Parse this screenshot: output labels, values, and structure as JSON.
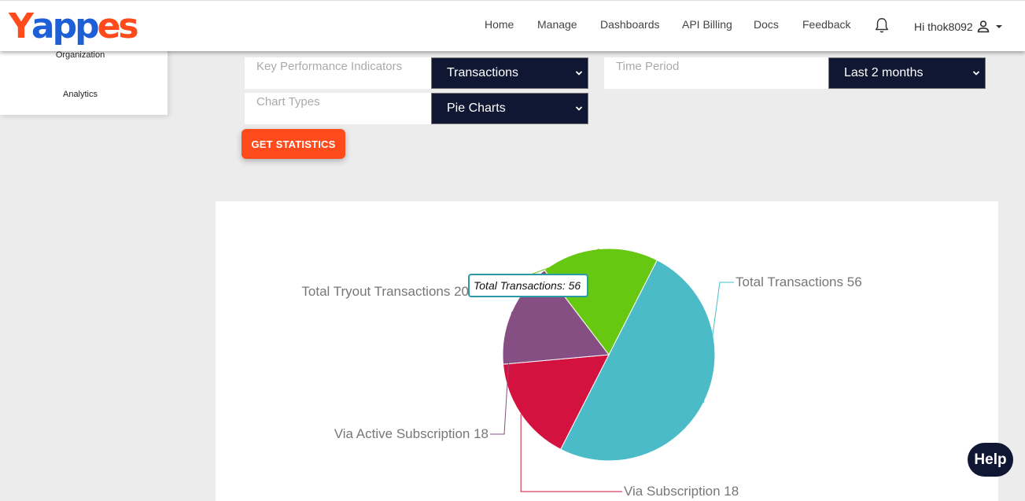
{
  "header": {
    "logo_text": "Yappes",
    "nav": [
      "Home",
      "Manage",
      "Dashboards",
      "API Billing",
      "Docs",
      "Feedback"
    ],
    "user_greeting": "Hi thok8092"
  },
  "sidebar": {
    "items": [
      "Organization",
      "Analytics"
    ]
  },
  "filters": {
    "kpi_label": "Key Performance Indicators",
    "kpi_value": "Transactions",
    "period_label": "Time Period",
    "period_value": "Last 2 months",
    "chart_type_label": "Chart Types",
    "chart_type_value": "Pie Charts",
    "submit_label": "GET STATISTICS"
  },
  "chart_data": {
    "type": "pie",
    "slices": [
      {
        "label": "Total Transactions",
        "value": 56,
        "color": "#4bbcc7"
      },
      {
        "label": "Via Subscription",
        "value": 18,
        "color": "#d4123f"
      },
      {
        "label": "Via Active Subscription",
        "value": 18,
        "color": "#864f84"
      },
      {
        "label": "Total Tryout Transactions",
        "value": 20,
        "color": "#66c810"
      }
    ],
    "label_texts": [
      "Total Transactions 56",
      "Via Subscription 18",
      "Via Active Subscription 18",
      "Total Tryout Transactions 20"
    ],
    "tooltip": {
      "label": "Total Transactions:",
      "value": "56"
    }
  },
  "help": {
    "label": "Help"
  },
  "colors": {
    "brand_orange": "#ff4a1c",
    "brand_blue": "#1d5fd6",
    "navy": "#0f1733"
  }
}
